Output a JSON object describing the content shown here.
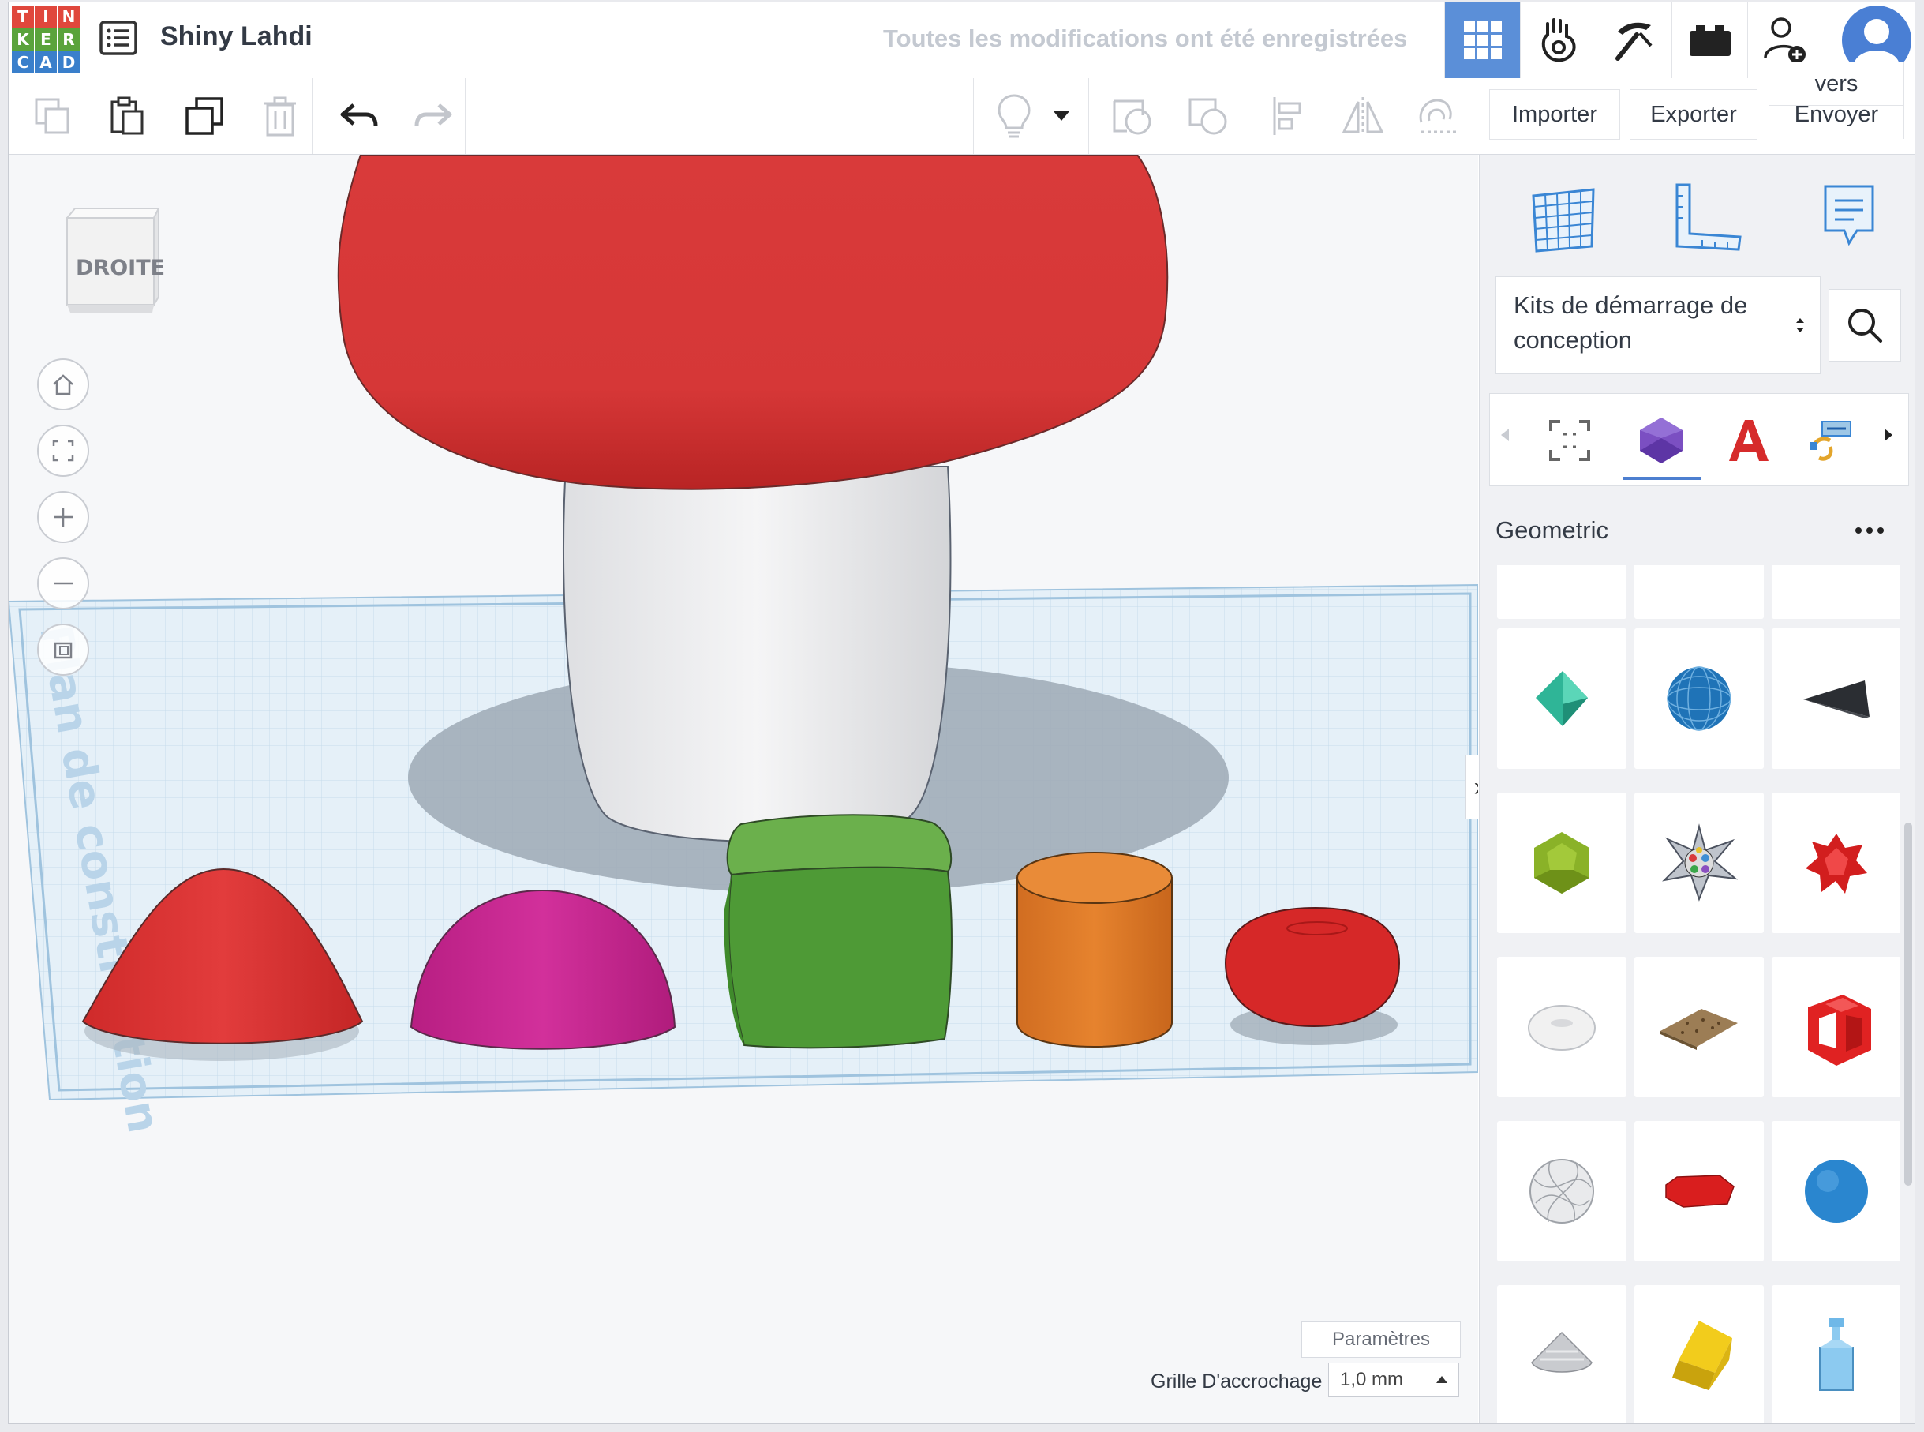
{
  "logo": {
    "letters": [
      "T",
      "I",
      "N",
      "K",
      "E",
      "R",
      "C",
      "A",
      "D"
    ],
    "colors": [
      "#e0473c",
      "#e0473c",
      "#e0473c",
      "#5aa33b",
      "#5aa33b",
      "#5aa33b",
      "#3a7fcb",
      "#3a7fcb",
      "#3a7fcb"
    ]
  },
  "header": {
    "design_name": "Shiny Lahdi",
    "save_status": "Toutes les modifications ont été enregistrées",
    "accent": "#5b8fd8"
  },
  "toolbar": {
    "import_label": "Importer",
    "export_label": "Exporter",
    "send_label_line1": "Envoyer",
    "send_label_line2": "vers"
  },
  "viewport": {
    "viewcube_face": "DROITE",
    "workplane_label": "Plan de construction",
    "params_label": "Paramètres",
    "snap_label": "Grille D'accrochage",
    "snap_value": "1,0 mm"
  },
  "panel": {
    "library_select": "Kits de démarrage de conception",
    "section_title": "Geometric"
  }
}
